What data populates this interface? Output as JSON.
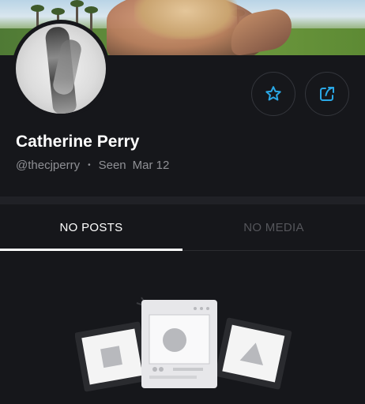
{
  "profile": {
    "name": "Catherine Perry",
    "handle": "@thecjperry",
    "separator": "•",
    "seen_label": "Seen",
    "seen_date": "Mar 12"
  },
  "actions": {
    "favorite_icon": "star-outline-icon",
    "share_icon": "share-icon",
    "accent_color": "#2aa8e6"
  },
  "tabs": [
    {
      "label": "NO POSTS",
      "active": true
    },
    {
      "label": "NO MEDIA",
      "active": false
    }
  ]
}
